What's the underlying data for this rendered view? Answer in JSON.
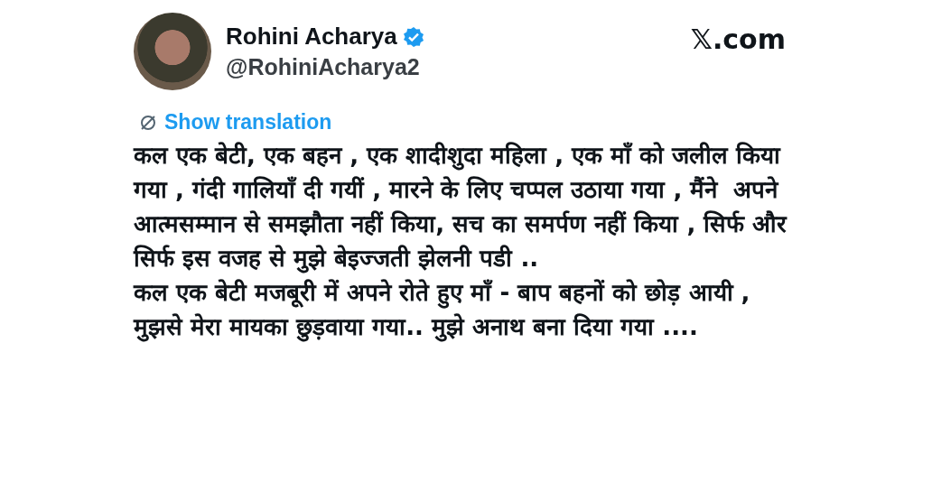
{
  "author": {
    "name": "Rohini Acharya",
    "verified": true,
    "handle": "@RohiniAcharya2"
  },
  "site": "𝕏.com",
  "translation_link": "Show translation",
  "paragraphs": [
    "कल एक बेटी, एक बहन , एक शादीशुदा महिला , एक माँ को जलील किया गया , गंदी गालियाँ दी गयीं , मारने के लिए चप्पल उठाया गया , मैंने  अपने आत्मसम्मान से समझौता नहीं किया, सच का समर्पण नहीं किया , सिर्फ और सिर्फ इस वजह से मुझे बेइज्जती झेलनी पडी ..",
    "कल एक बेटी मजबूरी में अपने रोते हुए माँ - बाप बहनों को छोड़ आयी , मुझसे मेरा मायका छुड़वाया गया.. मुझे अनाथ बना दिया गया ...."
  ]
}
